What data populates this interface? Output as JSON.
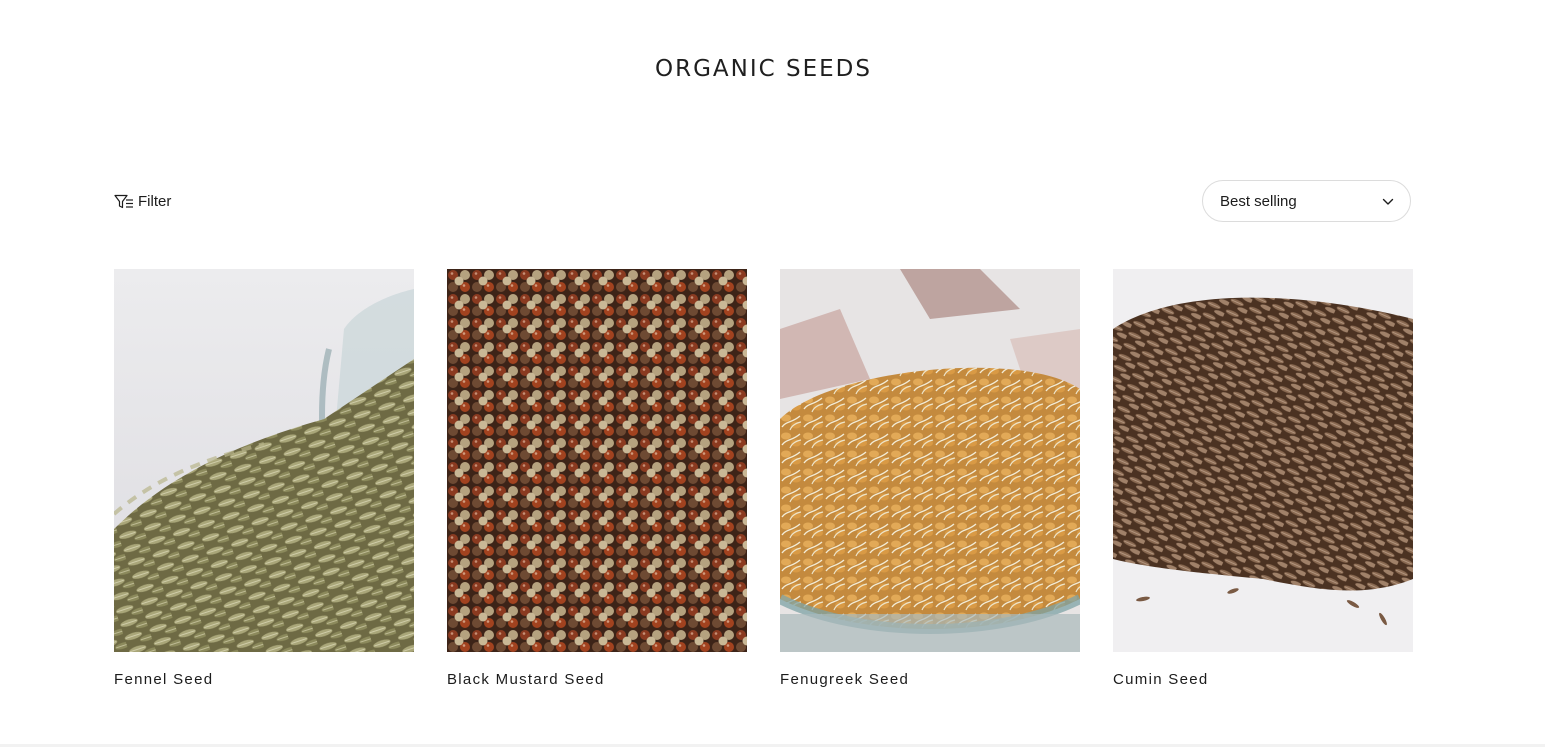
{
  "collection": {
    "title": "ORGANIC SEEDS"
  },
  "toolbar": {
    "filter_label": "Filter",
    "filter_icon": "filter-icon",
    "sort_selected": "Best selling",
    "sort_icon": "chevron-down-icon"
  },
  "products": [
    {
      "title": "Fennel Seed",
      "image": "fennel-seeds-spilling-from-glass-jar"
    },
    {
      "title": "Black Mustard Seed",
      "image": "black-mustard-seeds-closeup"
    },
    {
      "title": "Fenugreek Seed",
      "image": "sprouted-fenugreek-seeds-in-glass-bowl"
    },
    {
      "title": "Cumin Seed",
      "image": "pile-of-cumin-seeds"
    }
  ],
  "colors": {
    "text": "#1c1c1c",
    "border": "#dcdcdc",
    "background": "#ffffff"
  }
}
